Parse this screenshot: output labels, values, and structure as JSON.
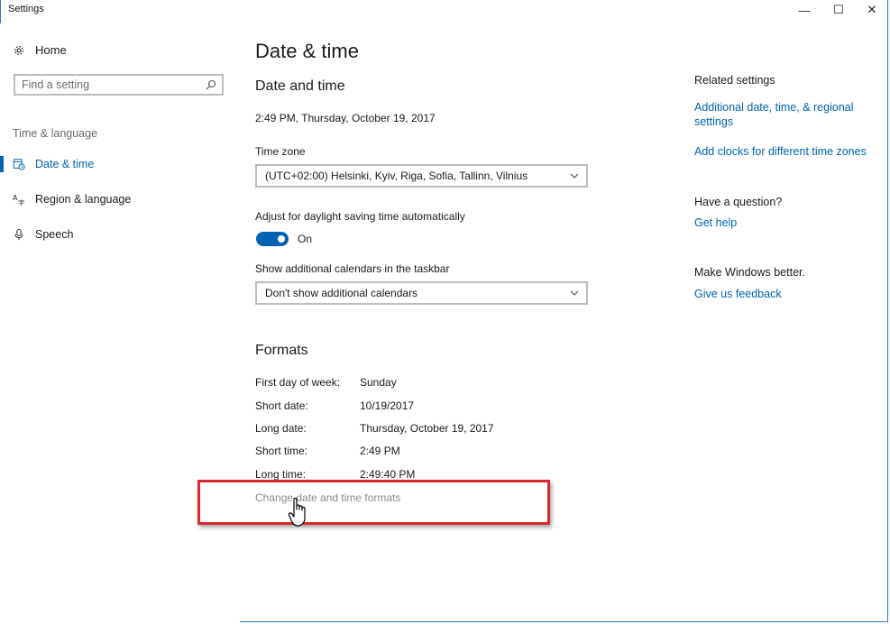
{
  "window": {
    "title": "Settings",
    "minimize": "—",
    "maximize": "☐",
    "close": "✕"
  },
  "sidebar": {
    "home_label": "Home",
    "search_placeholder": "Find a setting",
    "group_label": "Time & language",
    "items": [
      {
        "label": "Date & time",
        "icon": "calendar-clock-icon",
        "active": true
      },
      {
        "label": "Region & language",
        "icon": "region-language-icon",
        "active": false
      },
      {
        "label": "Speech",
        "icon": "microphone-icon",
        "active": false
      }
    ]
  },
  "main": {
    "page_title": "Date & time",
    "section_date_time": "Date and time",
    "current_datetime": "2:49 PM, Thursday, October 19, 2017",
    "time_zone_label": "Time zone",
    "time_zone_value": "(UTC+02:00) Helsinki, Kyiv, Riga, Sofia, Tallinn, Vilnius",
    "dst_label": "Adjust for daylight saving time automatically",
    "dst_state": "On",
    "calendars_label": "Show additional calendars in the taskbar",
    "calendars_value": "Don't show additional calendars",
    "formats_heading": "Formats",
    "formats": [
      {
        "key": "First day of week:",
        "value": "Sunday"
      },
      {
        "key": "Short date:",
        "value": "10/19/2017"
      },
      {
        "key": "Long date:",
        "value": "Thursday, October 19, 2017"
      },
      {
        "key": "Short time:",
        "value": "2:49 PM"
      },
      {
        "key": "Long time:",
        "value": "2:49:40 PM"
      }
    ],
    "change_formats_link": "Change date and time formats"
  },
  "related": {
    "heading": "Related settings",
    "link_regional": "Additional date, time, & regional settings",
    "link_clocks": "Add clocks for different time zones",
    "question_heading": "Have a question?",
    "get_help": "Get help",
    "better_heading": "Make Windows better.",
    "feedback": "Give us feedback"
  },
  "colors": {
    "accent": "#0063b1",
    "highlight": "#d9272e",
    "border": "#bdbdbd"
  }
}
